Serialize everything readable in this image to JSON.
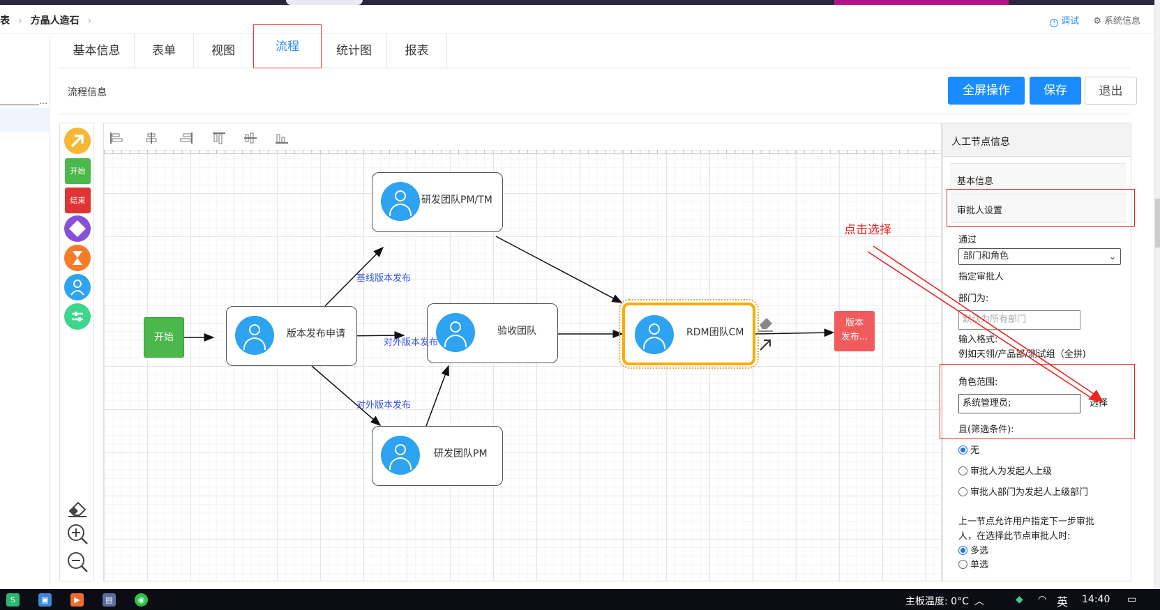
{
  "breadcrumb": {
    "items": [
      "列表",
      "方晶人造石"
    ]
  },
  "header": {
    "debug_label": "调试",
    "sysinfo_label": "系统信息"
  },
  "tabs": [
    {
      "label": "基本信息"
    },
    {
      "label": "表单"
    },
    {
      "label": "视图"
    },
    {
      "label": "流程",
      "active": true
    },
    {
      "label": "统计图"
    },
    {
      "label": "报表"
    }
  ],
  "flowbar": {
    "title": "流程信息",
    "fullscreen_label": "全屏操作",
    "save_label": "保存",
    "exit_label": "退出"
  },
  "palette": {
    "start_label": "开始",
    "end_label": "结束"
  },
  "diagram": {
    "start_node": "开始",
    "nodes": [
      {
        "label": "研发团队PM/TM"
      },
      {
        "label": "版本发布申请"
      },
      {
        "label": "验收团队"
      },
      {
        "label": "RDM团队CM",
        "selected": true
      },
      {
        "label": "研发团队PM"
      }
    ],
    "end_node": {
      "line1": "版本",
      "line2": "发布..."
    },
    "edge_labels": [
      "基线版本发布",
      "对外版本发布",
      "对外版本发布"
    ]
  },
  "annotation": "点击选择",
  "right_panel": {
    "title": "人工节点信息",
    "basic_label": "基本信息",
    "approver_label": "审批人设置",
    "pass_label": "通过",
    "select_value": "部门和角色",
    "assign_label": "指定审批人",
    "dept_label": "部门为:",
    "dept_placeholder": "默认为所有部门",
    "format_label": "输入格式:",
    "format_example": "例如天翎/产品部/测试组（全拼)",
    "role_label": "角色范围:",
    "role_value": "系统管理员;",
    "choose_label": "选择",
    "filter_label": "且(筛选条件):",
    "radio1": "无",
    "radio2": "审批人为发起人上级",
    "radio3": "审批人部门为发起人上级部门",
    "next_line1": "上一节点允许用户指定下一步审批",
    "next_line2": "人，在选择此节点审批人时:",
    "multi_label": "多选",
    "single_label": "单选"
  },
  "taskbar": {
    "temp_text": "主板温度: 0°C",
    "ime_label": "英",
    "time": "14:40"
  },
  "colors": {
    "accent": "#2d8cf0",
    "primary_button": "#1a8cff",
    "annotation_red": "#ee2222",
    "start_green": "#4ab84a",
    "end_red": "#f25b5b",
    "selected_orange": "#ffaa00",
    "avatar_blue": "#2ea3f2"
  }
}
